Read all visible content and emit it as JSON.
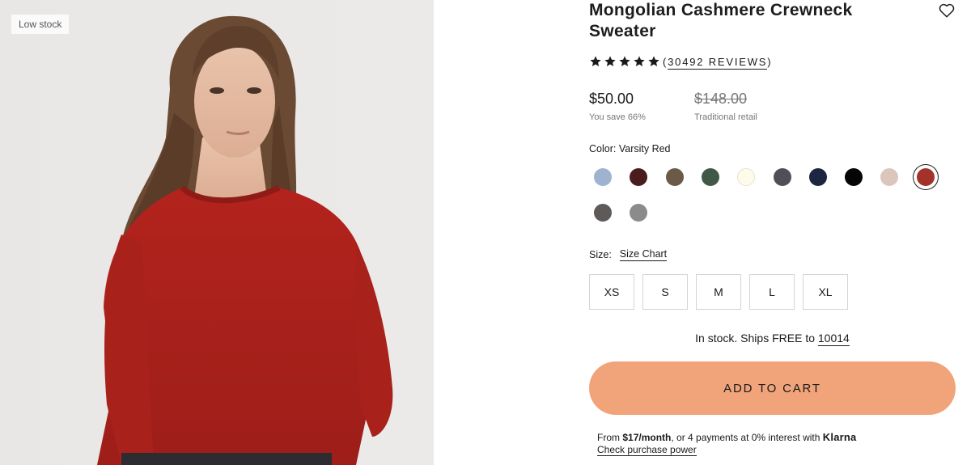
{
  "product": {
    "badge": "Low stock",
    "title": "Mongolian Cashmere Crewneck Sweater",
    "rating": {
      "stars": 5,
      "reviews_label": "30492 REVIEWS"
    },
    "price": {
      "current": "$50.00",
      "savings": "You save 66%",
      "original": "$148.00",
      "original_caption": "Traditional retail"
    },
    "color": {
      "label_prefix": "Color:",
      "selected": "Varsity Red",
      "swatches": [
        {
          "hex": "#9db3cf"
        },
        {
          "hex": "#4a1c1b"
        },
        {
          "hex": "#6b5a47"
        },
        {
          "hex": "#3f5946"
        },
        {
          "hex": "#fffbea"
        },
        {
          "hex": "#4f5056"
        },
        {
          "hex": "#1c2640"
        },
        {
          "hex": "#050505"
        },
        {
          "hex": "#dbc6bd"
        },
        {
          "hex": "#a3322b"
        },
        {
          "hex": "#5e5a58"
        },
        {
          "hex": "#8b8b8b"
        }
      ],
      "selected_index": 9
    },
    "size": {
      "label": "Size:",
      "chart_link": "Size Chart",
      "options": [
        "XS",
        "S",
        "M",
        "L",
        "XL"
      ]
    },
    "shipping": {
      "text": "In stock. Ships FREE to",
      "zip": "10014"
    },
    "cta": {
      "label": "ADD TO CART",
      "color": "#f1a37a"
    },
    "financing": {
      "from": "From",
      "monthly": "$17/month",
      "rest": ", or 4 payments at 0% interest with",
      "provider": "Klarna",
      "link": "Check purchase power"
    }
  },
  "icons": {
    "wishlist": "heart-outline-icon",
    "star": "star-icon"
  }
}
